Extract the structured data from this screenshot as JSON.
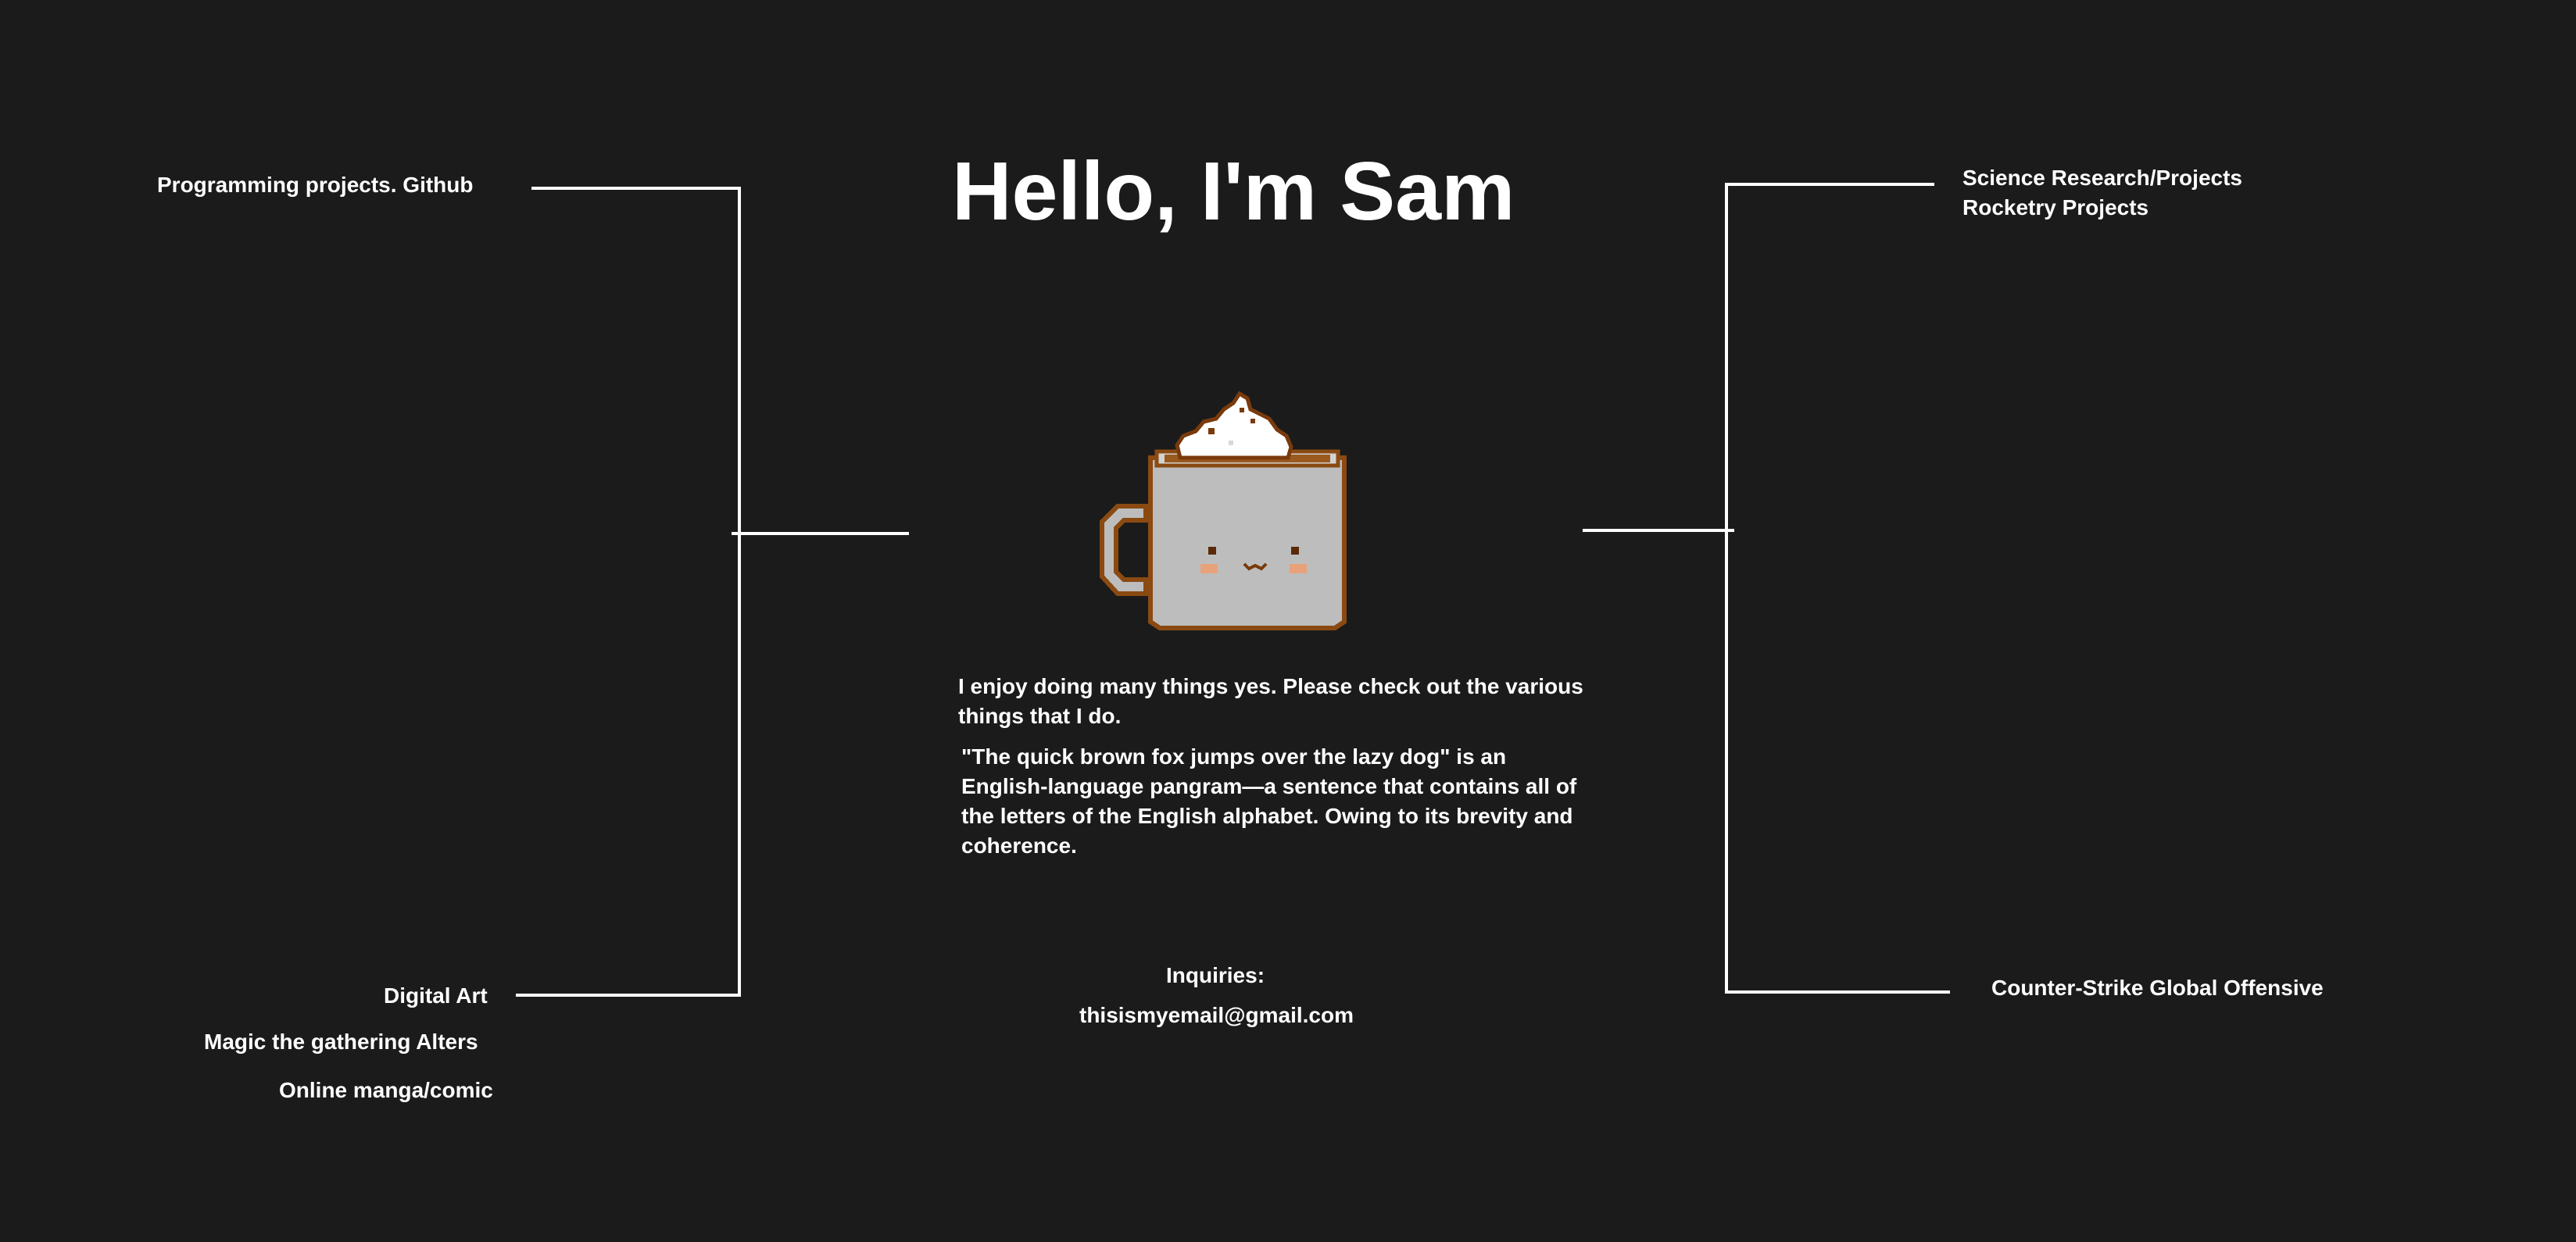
{
  "title": "Hello, I'm Sam",
  "intro": "I enjoy doing many things yes. Please check out  the various things that I do.",
  "pangram": "\"The quick brown fox jumps over the lazy dog\" is an English-language pangram—a sentence that contains all of the letters of the English alphabet. Owing to its brevity and coherence.",
  "left_links": {
    "programming": "Programming projects. Github",
    "digital_art": "Digital Art",
    "mtg_alters": "Magic the gathering Alters",
    "manga": "Online manga/comic"
  },
  "right_links": {
    "science": "Science Research/Projects",
    "rocketry": "Rocketry Projects",
    "csgo": "Counter-Strike Global Offensive"
  },
  "contact": {
    "label": "Inquiries:",
    "email": "thisismyemail@gmail.com"
  },
  "colors": {
    "background": "#1b1b1b",
    "text": "#ffffff",
    "lines": "#ffffff",
    "mug_body": "#bdbdbd",
    "mug_outline": "#8a4a12",
    "coffee": "#9a5a1e",
    "cream": "#ffffff",
    "blush": "#e8a27a"
  },
  "icons": {
    "mascot": "coffee-mug-with-whipped-cream"
  }
}
